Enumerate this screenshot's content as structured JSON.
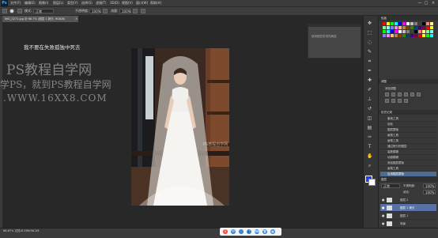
{
  "app": {
    "logo": "Ps"
  },
  "menu": {
    "items": [
      "文件(F)",
      "编辑(E)",
      "图像(I)",
      "图层(L)",
      "类型(Y)",
      "选择(S)",
      "滤镜(T)",
      "3D(D)",
      "视图(V)",
      "窗口(W)",
      "帮助(H)"
    ]
  },
  "window_controls": {
    "minimize": "—",
    "maximize": "□",
    "close": "×"
  },
  "options": {
    "mode_label": "模式:",
    "mode_value": "正常",
    "opacity_label": "不透明度:",
    "opacity_value": "100%",
    "flow_label": "流量:",
    "flow_value": "100%"
  },
  "document": {
    "tab_label": "IMG_0271.jpg @ 66.7% (图层 1 拷贝, RGB/8)",
    "tab_close": "×"
  },
  "canvas": {
    "caption": "我不要在失败孤独中死去"
  },
  "watermark": {
    "line1": "PS教程自学网",
    "line2": "学PS，就到PS教程自学网",
    "line3": ".WWW.16XX8.COM",
    "small": "PS教程自学网"
  },
  "float_panel": {
    "text": "使用图层前请先解锁"
  },
  "status": {
    "text": "66.67%  文档:8.33M/56.2M"
  },
  "tray": {
    "icons": [
      "S",
      "中",
      "·",
      "🎤",
      "⌨",
      "👕",
      "▦"
    ]
  },
  "panels": {
    "swatches_tab": "色板",
    "adjustments_tab": "调整",
    "adjustments_label": "添加调整",
    "history_tab": "历史记录",
    "layers_tab": "图层"
  },
  "history": {
    "items": [
      "套索工具",
      "羽化",
      "图层蒙版",
      "画笔工具",
      "画笔工具",
      "通过拷贝的图层",
      "高斯模糊",
      "动感模糊",
      "添加图层蒙版",
      "画笔工具",
      "应用图层蒙版"
    ],
    "selected_index": 10
  },
  "layers": {
    "controls": {
      "mode": "正常",
      "opacity_label": "不透明度:",
      "opacity": "100%",
      "fill_label": "填充:",
      "fill": "100%"
    },
    "items": [
      {
        "name": "图层 2",
        "selected": false
      },
      {
        "name": "图层 1 拷贝",
        "selected": true
      },
      {
        "name": "图层 1",
        "selected": false
      },
      {
        "name": "背景",
        "selected": false
      }
    ]
  },
  "colors": {
    "accent_blue": "#4f6d92",
    "layer_select": "#5872a6",
    "panel_bg": "#383838",
    "canvas_bg": "#282828"
  }
}
